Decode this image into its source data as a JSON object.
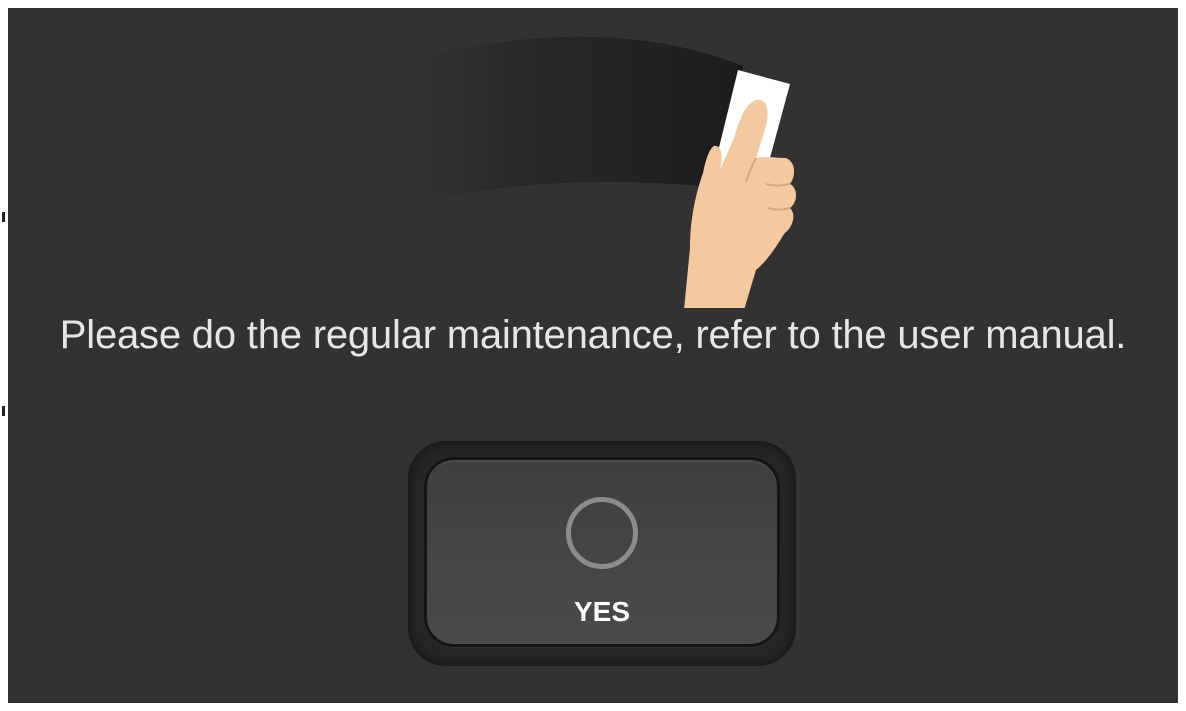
{
  "dialog": {
    "message": "Please do the regular maintenance, refer to the user manual.",
    "illustration_icon": "hand-wiping-icon"
  },
  "yes_button": {
    "label": "YES",
    "icon": "circle-o-icon"
  },
  "colors": {
    "background": "#323232",
    "text": "#e6e6e6",
    "skin": "#f5c9a0",
    "cloth": "#ffffff",
    "button_face": "#444444",
    "icon_ring": "#8c8c8c"
  }
}
